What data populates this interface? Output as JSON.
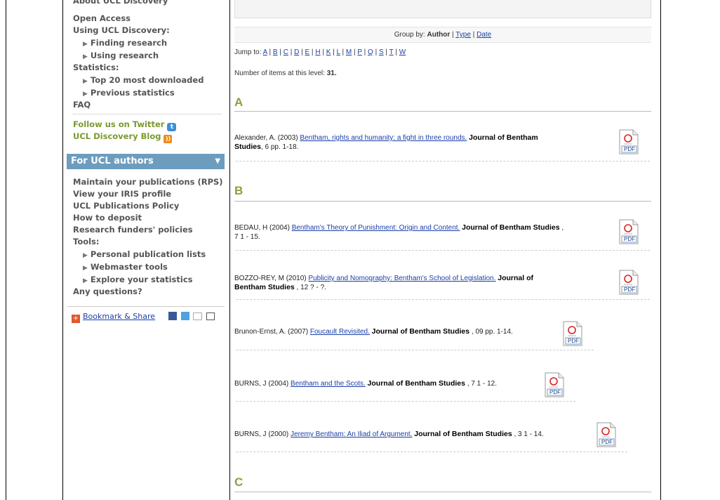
{
  "sidebar": {
    "top_item": "About UCL Discovery",
    "open_access": "Open Access",
    "using": "Using UCL Discovery:",
    "finding": "Finding research",
    "using_research": "Using research",
    "statistics": "Statistics:",
    "top20": "Top 20 most downloaded",
    "previous": "Previous statistics",
    "faq": "FAQ",
    "twitter": "Follow us on Twitter",
    "blog": "UCL Discovery Blog",
    "authors_header": "For UCL authors",
    "maintain": "Maintain your publications (RPS)",
    "iris": "View your IRIS profile",
    "policy": "UCL Publications Policy",
    "deposit": "How to deposit",
    "funders": "Research funders' policies",
    "tools": "Tools:",
    "personal": "Personal publication lists",
    "webmaster": "Webmaster tools",
    "explore": "Explore your statistics",
    "questions": "Any questions?",
    "bookmark": "Bookmark & Share"
  },
  "main": {
    "groupby_label": "Group by:",
    "groupby_author": "Author",
    "groupby_type": "Type",
    "groupby_date": "Date",
    "jump_label": "Jump to:",
    "jump_letters": [
      "A",
      "B",
      "C",
      "D",
      "E",
      "H",
      "K",
      "L",
      "M",
      "P",
      "Q",
      "S",
      "T",
      "W"
    ],
    "count_label": "Number of items at this level:",
    "count_value": "31.",
    "sections": [
      {
        "letter": "A"
      },
      {
        "letter": "B"
      },
      {
        "letter": "C"
      }
    ],
    "entries": [
      {
        "author": "Alexander, A. (2003)",
        "title": "Bentham, rights and humanity: a fight in three rounds.",
        "journal": "Journal of Bentham",
        "journal2": "Studies",
        "rest": ", 6 pp. 1-18."
      },
      {
        "author": "BEDAU, H (2004)",
        "title": "Bentham's Theory of Punishment: Origin and Content.",
        "journal": "Journal of Bentham Studies",
        "rest": " ,",
        "rest2": "7 1 - 15."
      },
      {
        "author": "BOZZO-REY, M (2010)",
        "title": "Publicity and Nomography: Bentham's School of Legislation.",
        "journal": "Journal of",
        "journal2": "Bentham Studies",
        "rest": " , 12 ? - ?."
      },
      {
        "author": "Brunon-Ernst, A. (2007)",
        "title": "Foucault Revisited.",
        "journal": "Journal of Bentham Studies",
        "rest": " , 09 pp. 1-14."
      },
      {
        "author": "BURNS, J (2004)",
        "title": "Bentham and the Scots.",
        "journal": "Journal of Bentham Studies",
        "rest": " , 7 1 - 12."
      },
      {
        "author": "BURNS, J (2000)",
        "title": "Jeremy Bentham: An Iliad of Argument.",
        "journal": "Journal of Bentham Studies",
        "rest": " , 3 1 - 14."
      }
    ],
    "pdf_label": "PDF"
  }
}
